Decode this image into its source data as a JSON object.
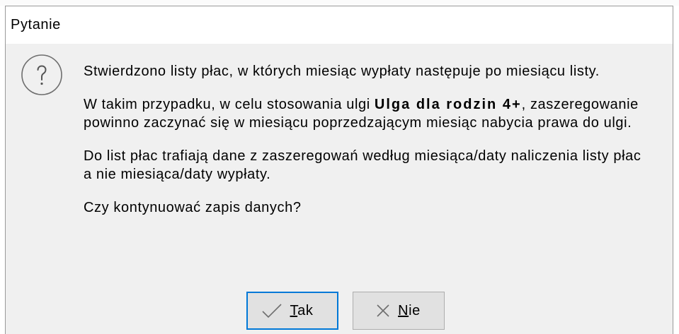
{
  "window": {
    "title": "Pytanie"
  },
  "dialog": {
    "icon": "question-icon",
    "message": {
      "paragraph_1": {
        "line_1": "Stwierdzono listy płac, w których miesiąc wypłaty następuje po miesiącu listy."
      },
      "paragraph_2": {
        "line_1_before": "W takim przypadku, w celu stosowania ulgi ",
        "line_1_bold": "Ulga dla rodzin 4+",
        "line_1_after": ", zaszeregowanie",
        "line_2": "powinno zaczynać się w miesiącu poprzedzającym miesiąc nabycia prawa do ulgi."
      },
      "paragraph_3": {
        "line_1": "Do list płac trafiają dane z zaszeregowań według miesiąca/daty naliczenia listy płac",
        "line_2": "a nie miesiąca/daty wypłaty."
      },
      "paragraph_4": {
        "line_1": "Czy kontynuować zapis danych?"
      }
    },
    "buttons": {
      "yes": {
        "label": "Tak",
        "icon": "checkmark-icon",
        "is_default": true,
        "mnemonic_underlined": true
      },
      "no": {
        "label": "Nie",
        "icon": "close-icon",
        "is_default": false,
        "mnemonic_underlined": true
      }
    }
  },
  "colors": {
    "titlebar_bg": "#ffffff",
    "content_bg": "#f0f0f0",
    "text": "#000000",
    "window_border": "#9a9a9a",
    "button_bg": "#e1e1e1",
    "button_border": "#adadad",
    "default_button_border": "#0078d7",
    "icon_gray": "#6e6e6e"
  }
}
